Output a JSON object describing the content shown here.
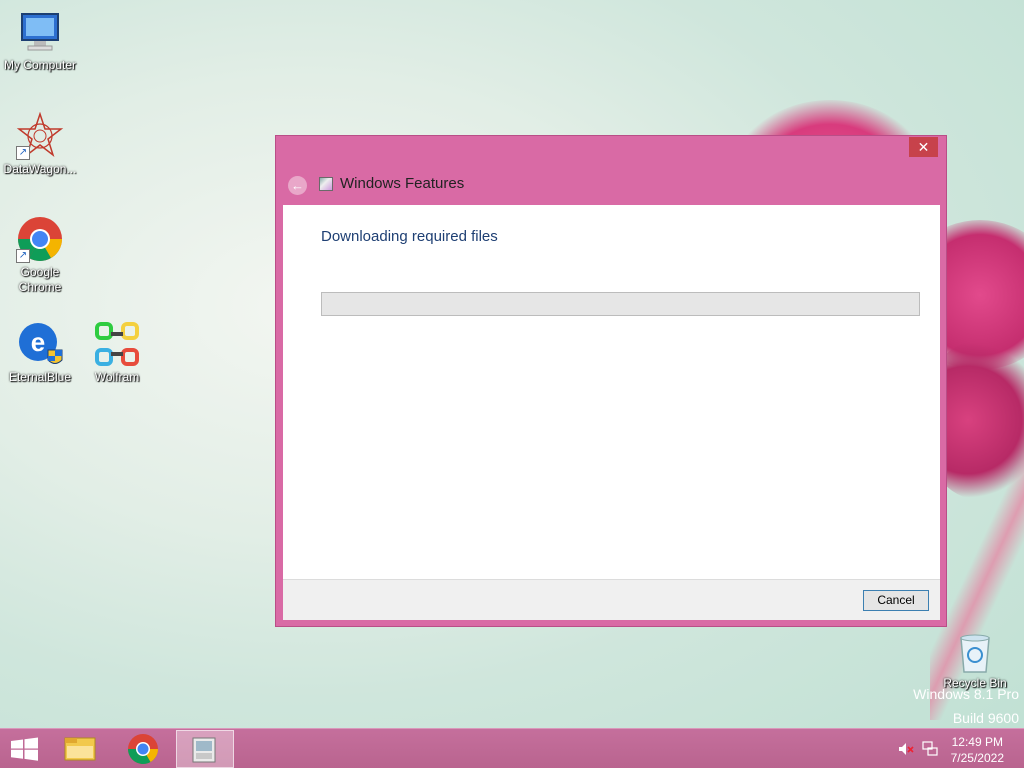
{
  "desktop": {
    "icons": [
      {
        "label": "My Computer",
        "icon": "computer-icon"
      },
      {
        "label": "DataWagon...",
        "icon": "datawagon-icon"
      },
      {
        "label": "Google Chrome",
        "icon": "chrome-icon"
      },
      {
        "label": "EternalBlue",
        "icon": "eternalblue-icon"
      },
      {
        "label": "Wolfram",
        "icon": "wolfram-icon"
      },
      {
        "label": "Recycle Bin",
        "icon": "recycle-bin-icon"
      }
    ],
    "watermark": {
      "line1": "Windows 8.1 Pro",
      "line2": "Build 9600"
    }
  },
  "dialog": {
    "title": "Windows Features",
    "close_label": "✕",
    "back_label": "←",
    "heading": "Downloading required files",
    "progress": 0,
    "cancel_label": "Cancel"
  },
  "taskbar": {
    "start_icon": "windows-start-icon",
    "items": [
      "file-explorer-icon",
      "chrome-icon",
      "windows-features-icon"
    ],
    "tray": [
      "volume-muted-icon",
      "network-icon"
    ],
    "time": "12:49 PM",
    "date": "7/25/2022"
  },
  "colors": {
    "accent": "#d96aa5",
    "taskbar": "#c56f9c",
    "heading": "#1e3f73"
  }
}
